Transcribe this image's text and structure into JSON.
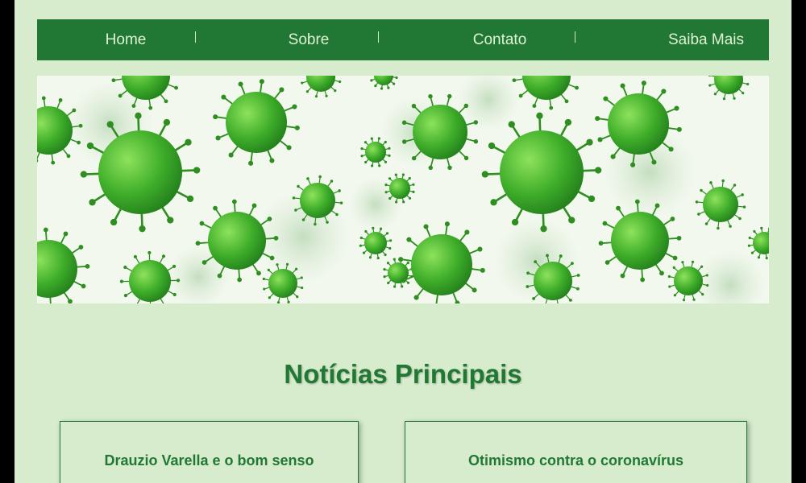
{
  "nav": {
    "items": [
      {
        "label": "Home"
      },
      {
        "label": "Sobre"
      },
      {
        "label": "Contato"
      },
      {
        "label": "Saiba Mais"
      }
    ],
    "separator": "|"
  },
  "banner": {
    "subject": "coronavirus-illustration",
    "colors": {
      "virus": "#3fae2a",
      "spike": "#2e8e1f",
      "background": "#f2f8ee"
    }
  },
  "section": {
    "title": "Notícias Principais"
  },
  "cards": [
    {
      "title": "Drauzio Varella e o bom senso"
    },
    {
      "title": "Otimismo contra o coronavírus"
    }
  ],
  "colors": {
    "primary": "#217834",
    "background": "#d7eccc",
    "nav_text": "#dff3d3"
  }
}
